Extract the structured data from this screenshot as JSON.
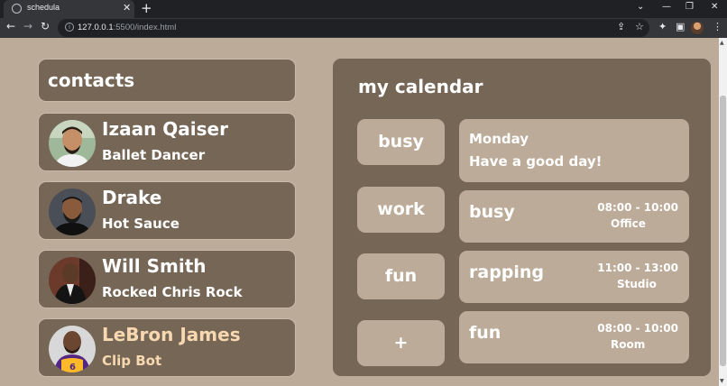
{
  "browser": {
    "tab_title": "schedula",
    "url_host": "127.0.0.1",
    "url_rest": ":5500/index.html"
  },
  "contacts": {
    "title": "contacts",
    "items": [
      {
        "name": "Izaan Qaiser",
        "role": "Ballet Dancer"
      },
      {
        "name": "Drake",
        "role": "Hot Sauce"
      },
      {
        "name": "Will Smith",
        "role": "Rocked Chris Rock"
      },
      {
        "name": "LeBron James",
        "role": "Clip Bot"
      }
    ]
  },
  "calendar": {
    "title": "my calendar",
    "categories": [
      "busy",
      "work",
      "fun",
      "+"
    ],
    "today": {
      "day": "Monday",
      "message": "Have a good day!"
    },
    "events": [
      {
        "name": "busy",
        "time": "08:00 - 10:00",
        "place": "Office"
      },
      {
        "name": "rapping",
        "time": "11:00 - 13:00",
        "place": "Studio"
      },
      {
        "name": "fun",
        "time": "08:00 - 10:00",
        "place": "Room"
      }
    ]
  },
  "colors": {
    "page_bg": "#bcab98",
    "card_bg": "#766656",
    "highlight_text": "#f7d8b0"
  }
}
